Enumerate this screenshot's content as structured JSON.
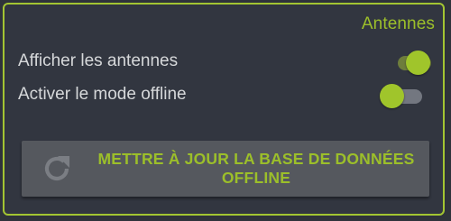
{
  "section": {
    "title": "Antennes"
  },
  "settings": [
    {
      "label": "Afficher les antennes",
      "enabled": true
    },
    {
      "label": "Activer le mode offline",
      "enabled": false
    }
  ],
  "update_button": {
    "line1": "METTRE À JOUR LA BASE DE DONNÉES",
    "line2": "OFFLINE",
    "icon": "refresh-icon"
  },
  "colors": {
    "accent": "#a0c52b",
    "background": "#2f333b",
    "button": "#55585e",
    "label_text": "#d6d8da"
  }
}
